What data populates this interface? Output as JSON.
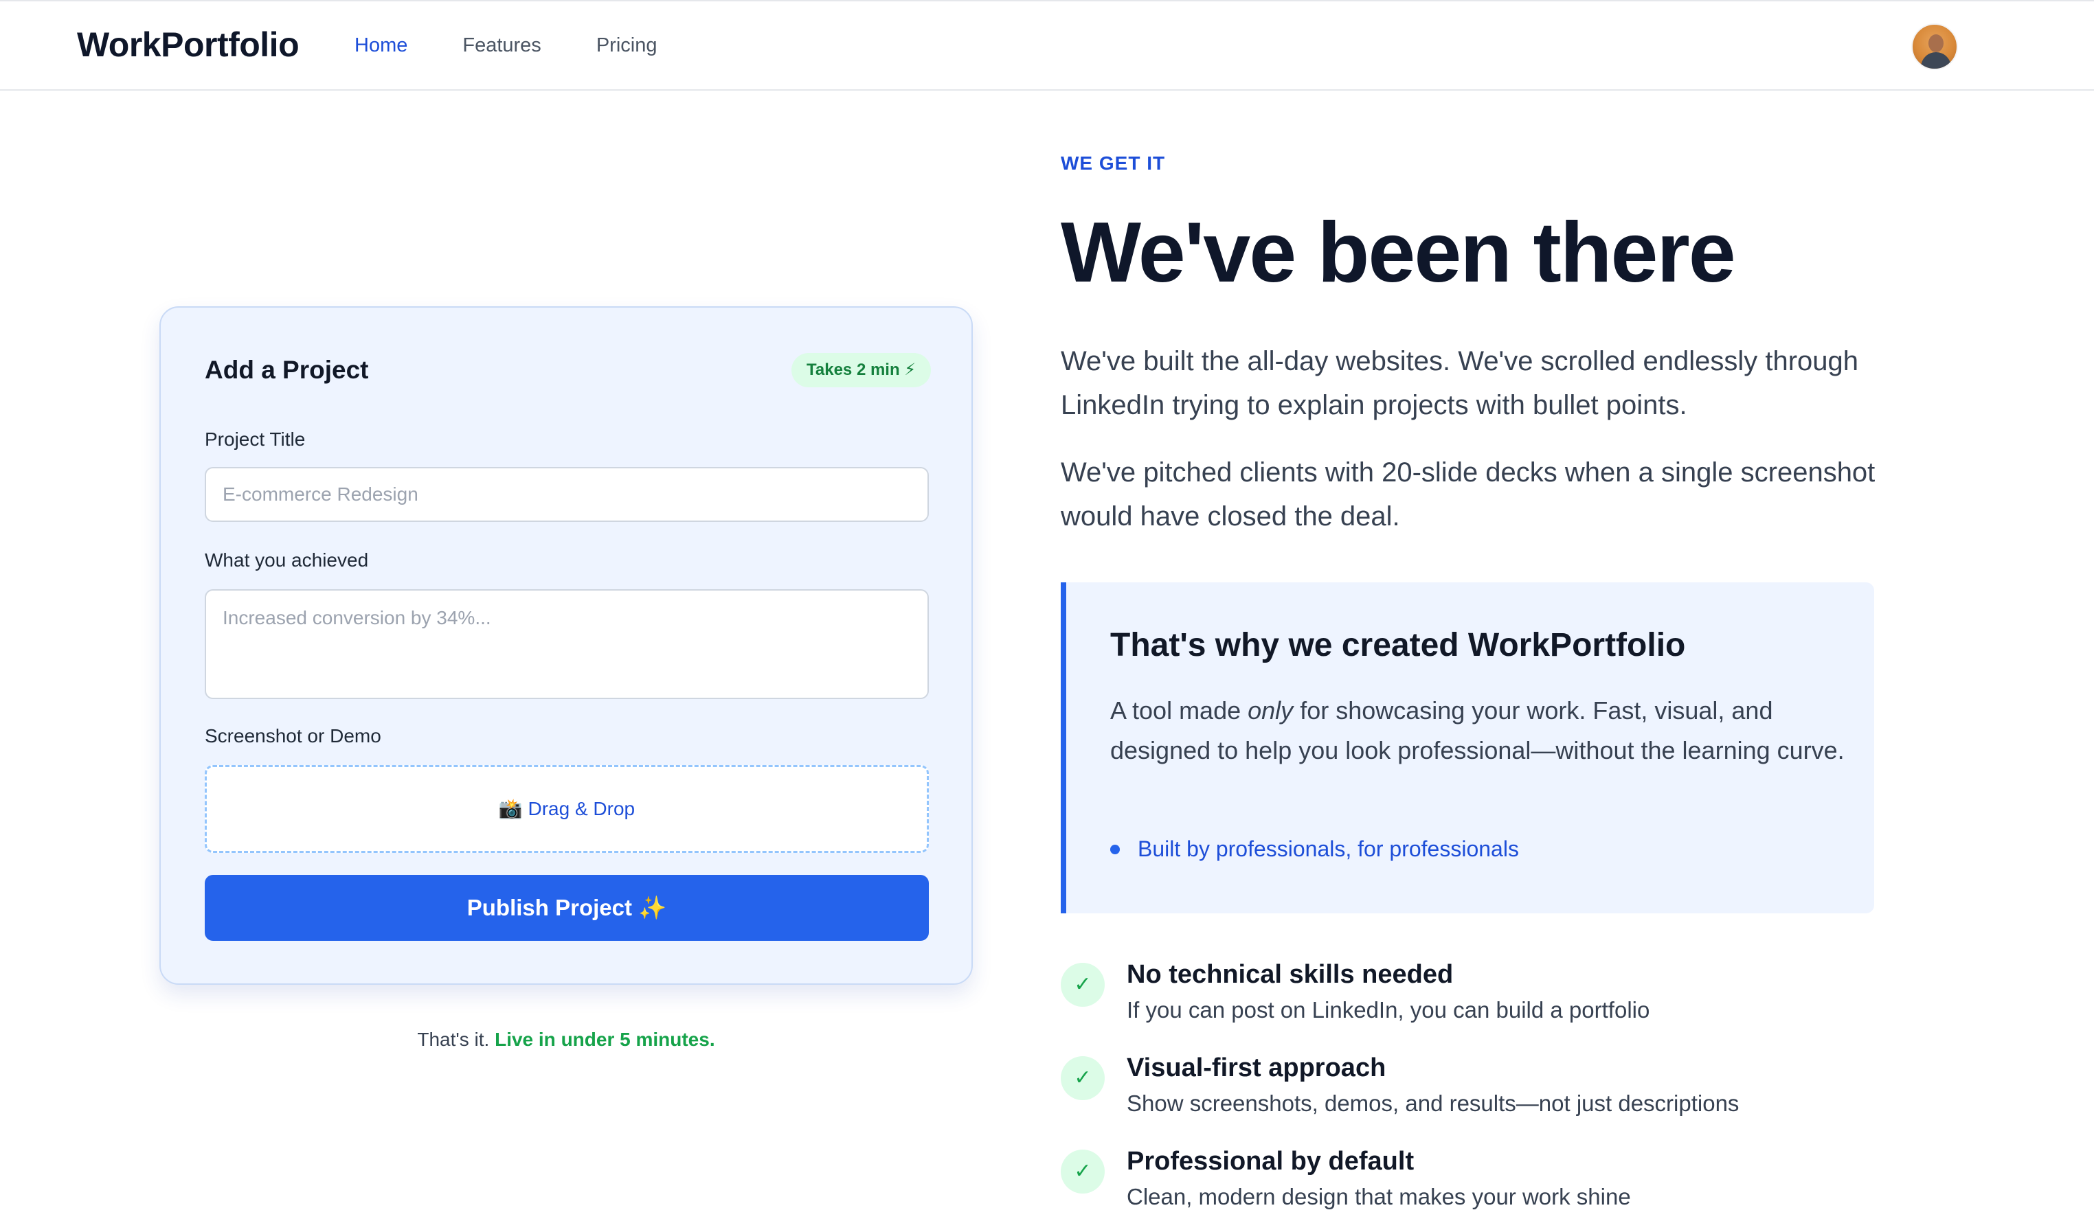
{
  "header": {
    "brand": "WorkPortfolio",
    "nav": [
      {
        "label": "Home",
        "active": true
      },
      {
        "label": "Features",
        "active": false
      },
      {
        "label": "Pricing",
        "active": false
      }
    ]
  },
  "card": {
    "title": "Add a Project",
    "badge": "Takes 2 min ⚡",
    "project_title_label": "Project Title",
    "project_title_placeholder": "E-commerce Redesign",
    "achieved_label": "What you achieved",
    "achieved_placeholder": "Increased conversion by 34%...",
    "screenshot_label": "Screenshot or Demo",
    "dropzone_label": "📸 Drag & Drop",
    "publish_label": "Publish Project ✨"
  },
  "note": {
    "prefix": "That's it.",
    "highlight": "Live in under 5 minutes."
  },
  "hero": {
    "eyebrow": "WE GET IT",
    "headline": "We've been there",
    "para1": "We've built the all-day websites. We've scrolled endlessly through LinkedIn trying to explain projects with bullet points.",
    "para2": "We've pitched clients with 20-slide decks when a single screenshot would have closed the deal."
  },
  "callout": {
    "title": "That's why we created WorkPortfolio",
    "text_before": "A tool made ",
    "text_emphasis": "only",
    "text_after": " for showcasing your work. Fast, visual, and designed to help you look professional—without the learning curve.",
    "bullet": "Built by professionals, for professionals"
  },
  "features": [
    {
      "title": "No technical skills needed",
      "desc": "If you can post on LinkedIn, you can build a portfolio"
    },
    {
      "title": "Visual-first approach",
      "desc": "Show screenshots, demos, and results—not just descriptions"
    },
    {
      "title": "Professional by default",
      "desc": "Clean, modern design that makes your work shine"
    }
  ],
  "icons": {
    "check": "✓"
  },
  "colors": {
    "accent": "#2563eb",
    "success": "#16a34a",
    "card_bg": "#eef4ff"
  }
}
